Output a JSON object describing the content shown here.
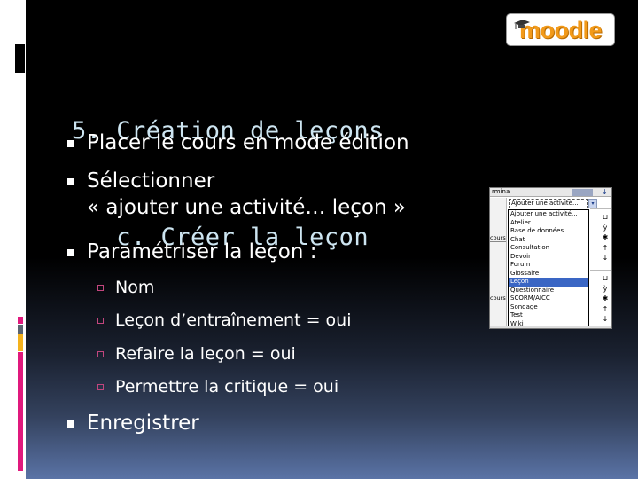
{
  "slide": {
    "title_line1": "5. Création de leçons",
    "title_line2": "   c. Créer la leçon",
    "logo_text": "moodle",
    "colors": {
      "title": "#cde5f1",
      "body_text": "#ffffff",
      "sub_bullet": "#c2467e",
      "accent_pink": "#e0197d",
      "accent_gray": "#5a6470",
      "accent_orange": "#f4b21d",
      "logo_orange": "#f29a1a",
      "gradient_bottom": "#5a73a6"
    },
    "bullets": [
      {
        "text": "Placer le cours en mode édition"
      },
      {
        "text": "Sélectionner",
        "text_line2": "« ajouter une activité… leçon »"
      },
      {
        "text": "Paramétriser la leçon :"
      }
    ],
    "sub_bullets": [
      {
        "text": "Nom"
      },
      {
        "text": "Leçon d’entraînement = oui"
      },
      {
        "text": "Refaire la leçon = oui"
      },
      {
        "text": "Permettre la critique = oui"
      }
    ],
    "final_bullet": {
      "text": "Enregistrer"
    }
  },
  "screenshot": {
    "topbar_text": "rmina",
    "select_value": "Ajouter une activité...",
    "left_label": "cours",
    "dropdown_items": [
      "Ajouter une activité...",
      "Atelier",
      "Base de données",
      "Chat",
      "Consultation",
      "Devoir",
      "Forum",
      "Glossaire",
      "Leçon",
      "Questionnaire",
      "SCORM/AICC",
      "Sondage",
      "Test",
      "Wiki"
    ],
    "selected_item": "Leçon",
    "right_icons": [
      "edit-icon",
      "hide-icon",
      "eye-icon",
      "up-arrow-icon",
      "down-arrow-icon"
    ],
    "right_glyphs": [
      "⊔",
      "ỳ",
      "✱",
      "↑",
      "↓"
    ]
  }
}
